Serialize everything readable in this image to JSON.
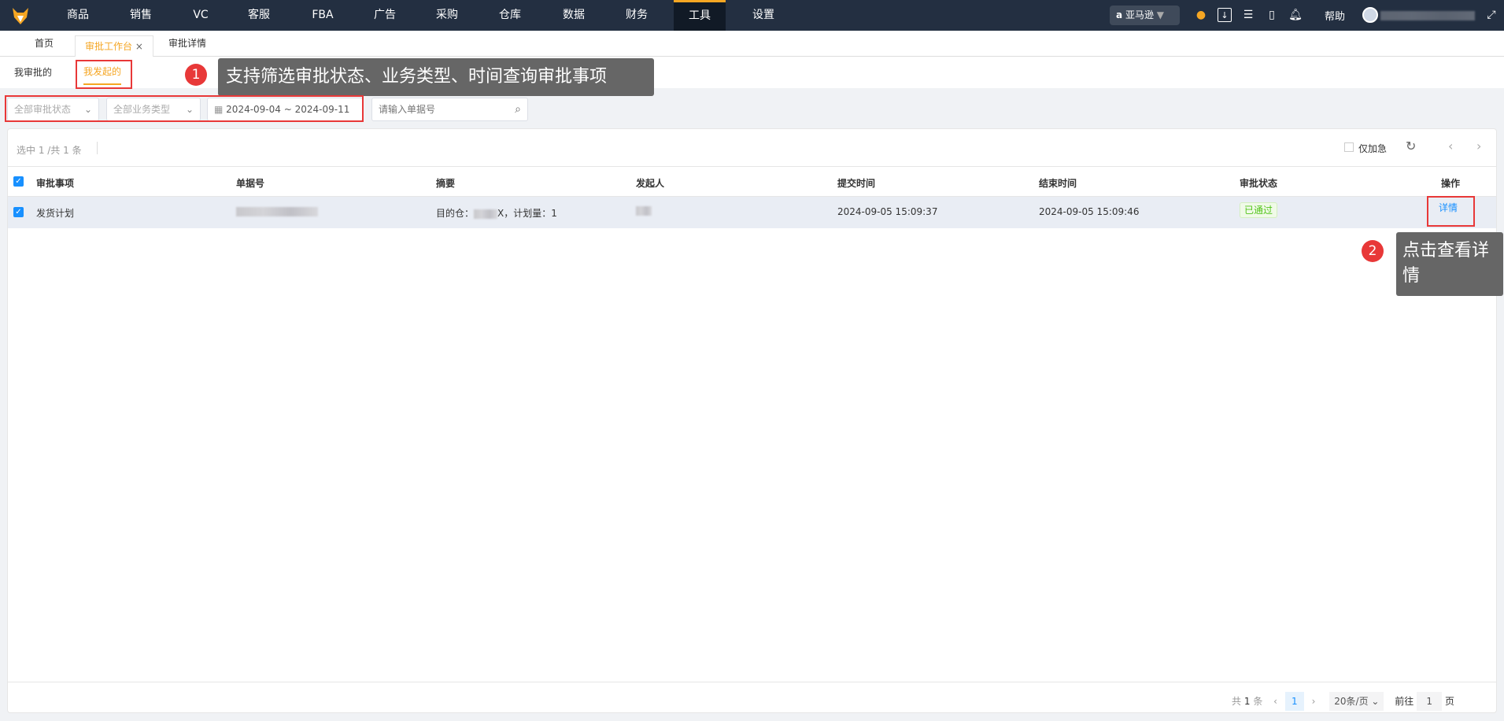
{
  "nav": {
    "items": [
      "商品",
      "销售",
      "VC",
      "客服",
      "FBA",
      "广告",
      "采购",
      "仓库",
      "数据",
      "财务",
      "工具",
      "设置"
    ],
    "active": "工具",
    "marketplace": "亚马逊",
    "help": "帮助"
  },
  "tabs": [
    {
      "label": "首页"
    },
    {
      "label": "审批工作台",
      "close": "×"
    },
    {
      "label": "审批详情"
    }
  ],
  "subtabs": [
    "我审批的",
    "我发起的"
  ],
  "annotations": [
    {
      "num": "1",
      "text": "支持筛选审批状态、业务类型、时间查询审批事项"
    },
    {
      "num": "2",
      "text": "点击查看详情"
    }
  ],
  "filters": {
    "status": "全部审批状态",
    "type": "全部业务类型",
    "date_range": "2024-09-04 ~ 2024-09-11",
    "search_placeholder": "请输入单据号"
  },
  "toolbar": {
    "selection": "选中 1 /共 1 条",
    "urgent_only": "仅加急"
  },
  "table": {
    "headers": [
      "审批事项",
      "单据号",
      "摘要",
      "发起人",
      "提交时间",
      "结束时间",
      "审批状态",
      "操作"
    ],
    "rows": [
      {
        "item": "发货计划",
        "summary_prefix": "目的仓：",
        "summary_suffix": "X，计划量：1",
        "submit_time": "2024-09-05 15:09:37",
        "end_time": "2024-09-05 15:09:46",
        "status": "已通过",
        "action": "详情"
      }
    ]
  },
  "pagination": {
    "total_prefix": "共",
    "total": "1",
    "total_suffix": "条",
    "current": "1",
    "page_size": "20条/页",
    "goto_label": "前往",
    "goto_value": "1",
    "page_suffix": "页"
  },
  "colors": {
    "accent": "#f5a623",
    "link": "#1890ff",
    "success": "#52c41a",
    "annotation_red": "#e83838"
  }
}
